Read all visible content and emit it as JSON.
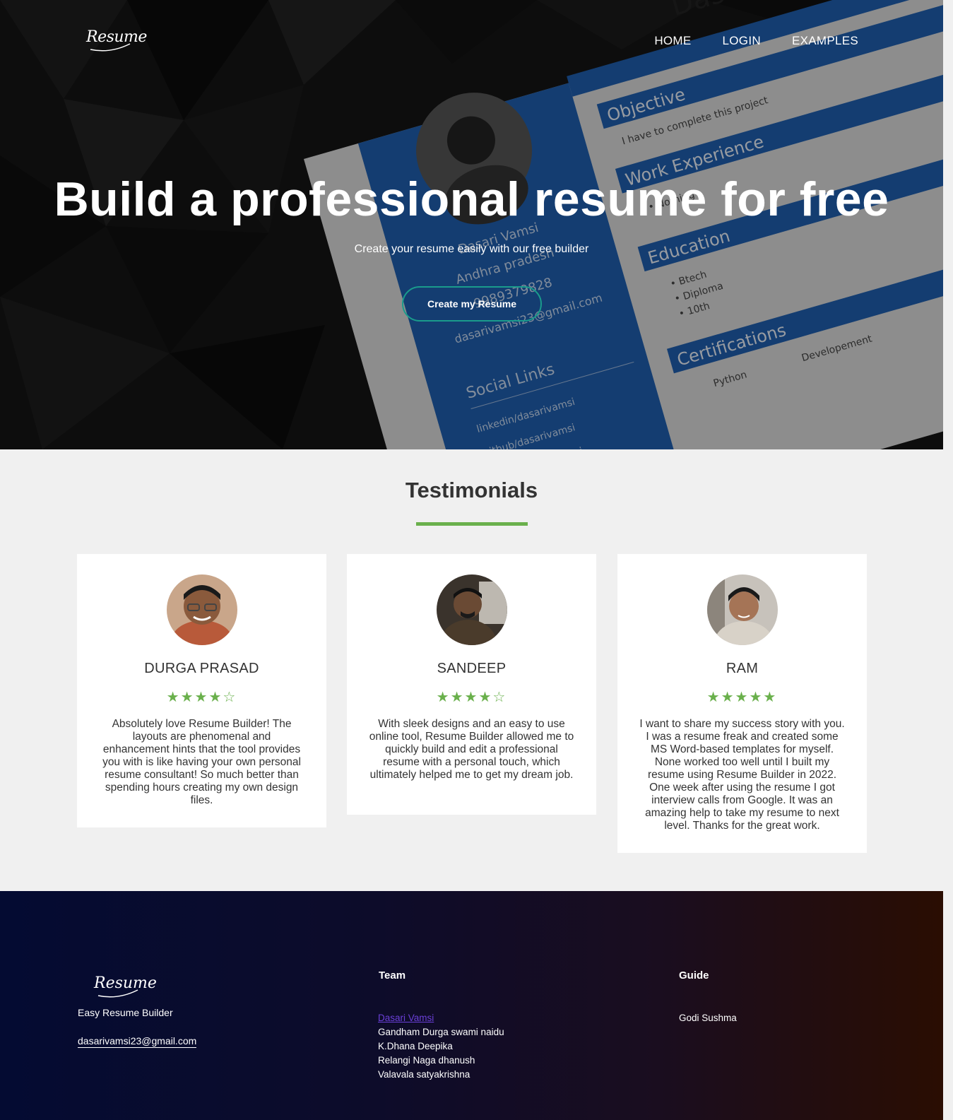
{
  "nav": {
    "logo": "Resume",
    "links": [
      "HOME",
      "LOGIN",
      "EXAMPLES"
    ]
  },
  "hero": {
    "title": "Build a professional resume for free",
    "subtitle": "Create your resume easily with our free builder",
    "cta": "Create my Resume",
    "bg_resume": {
      "name": "Dasari Vamsi",
      "objective_heading": "Objective",
      "objective_text": "I have to complete this project",
      "work_heading": "Work Experience",
      "work_item": "Nothing",
      "education_heading": "Education",
      "education_items": [
        "Btech",
        "Diploma",
        "10th"
      ],
      "cert_heading": "Certifications",
      "cert_items": [
        "Python",
        "Developement"
      ],
      "side_name": "Dasari Vamsi",
      "side_location": "Andhra pradesh",
      "side_phone": "9989379828",
      "side_email": "dasarivamsi23@gmail.com",
      "social_heading": "Social Links",
      "social_items": [
        "linkedin/dasarivamsi",
        "github/dasarivamsi",
        "twitter/dasarivamsi"
      ]
    }
  },
  "testimonials": {
    "title": "Testimonials",
    "cards": [
      {
        "name": "DURGA PRASAD",
        "rating": 4,
        "stars": "★★★★☆",
        "text": "Absolutely love Resume Builder! The layouts are phenomenal and enhancement hints that the tool provides you with is like having your own personal resume consultant! So much better than spending hours creating my own design files."
      },
      {
        "name": "SANDEEP",
        "rating": 4,
        "stars": "★★★★☆",
        "text": "With sleek designs and an easy to use online tool, Resume Builder allowed me to quickly build and edit a professional resume with a personal touch, which ultimately helped me to get my dream job."
      },
      {
        "name": "RAM",
        "rating": 5,
        "stars": "★★★★★",
        "text": "I want to share my success story with you. I was a resume freak and created some MS Word-based templates for myself. None worked too well until I built my resume using Resume Builder in 2022. One week after using the resume I got interview calls from Google. It was an amazing help to take my resume to next level. Thanks for the great work."
      }
    ]
  },
  "footer": {
    "logo": "Resume",
    "tagline": "Easy Resume Builder",
    "email": "dasarivamsi23@gmail.com",
    "team_heading": "Team",
    "team": [
      "Dasari Vamsi",
      "Gandham Durga swami naidu",
      "K.Dhana Deepika",
      "Relangi Naga dhanush",
      "Valavala satyakrishna"
    ],
    "guide_heading": "Guide",
    "guide": [
      "Godi Sushma"
    ]
  },
  "colors": {
    "accent_green": "#6ab04c",
    "cta_border": "#1a9c8c",
    "resume_blue": "#1f5fae"
  }
}
